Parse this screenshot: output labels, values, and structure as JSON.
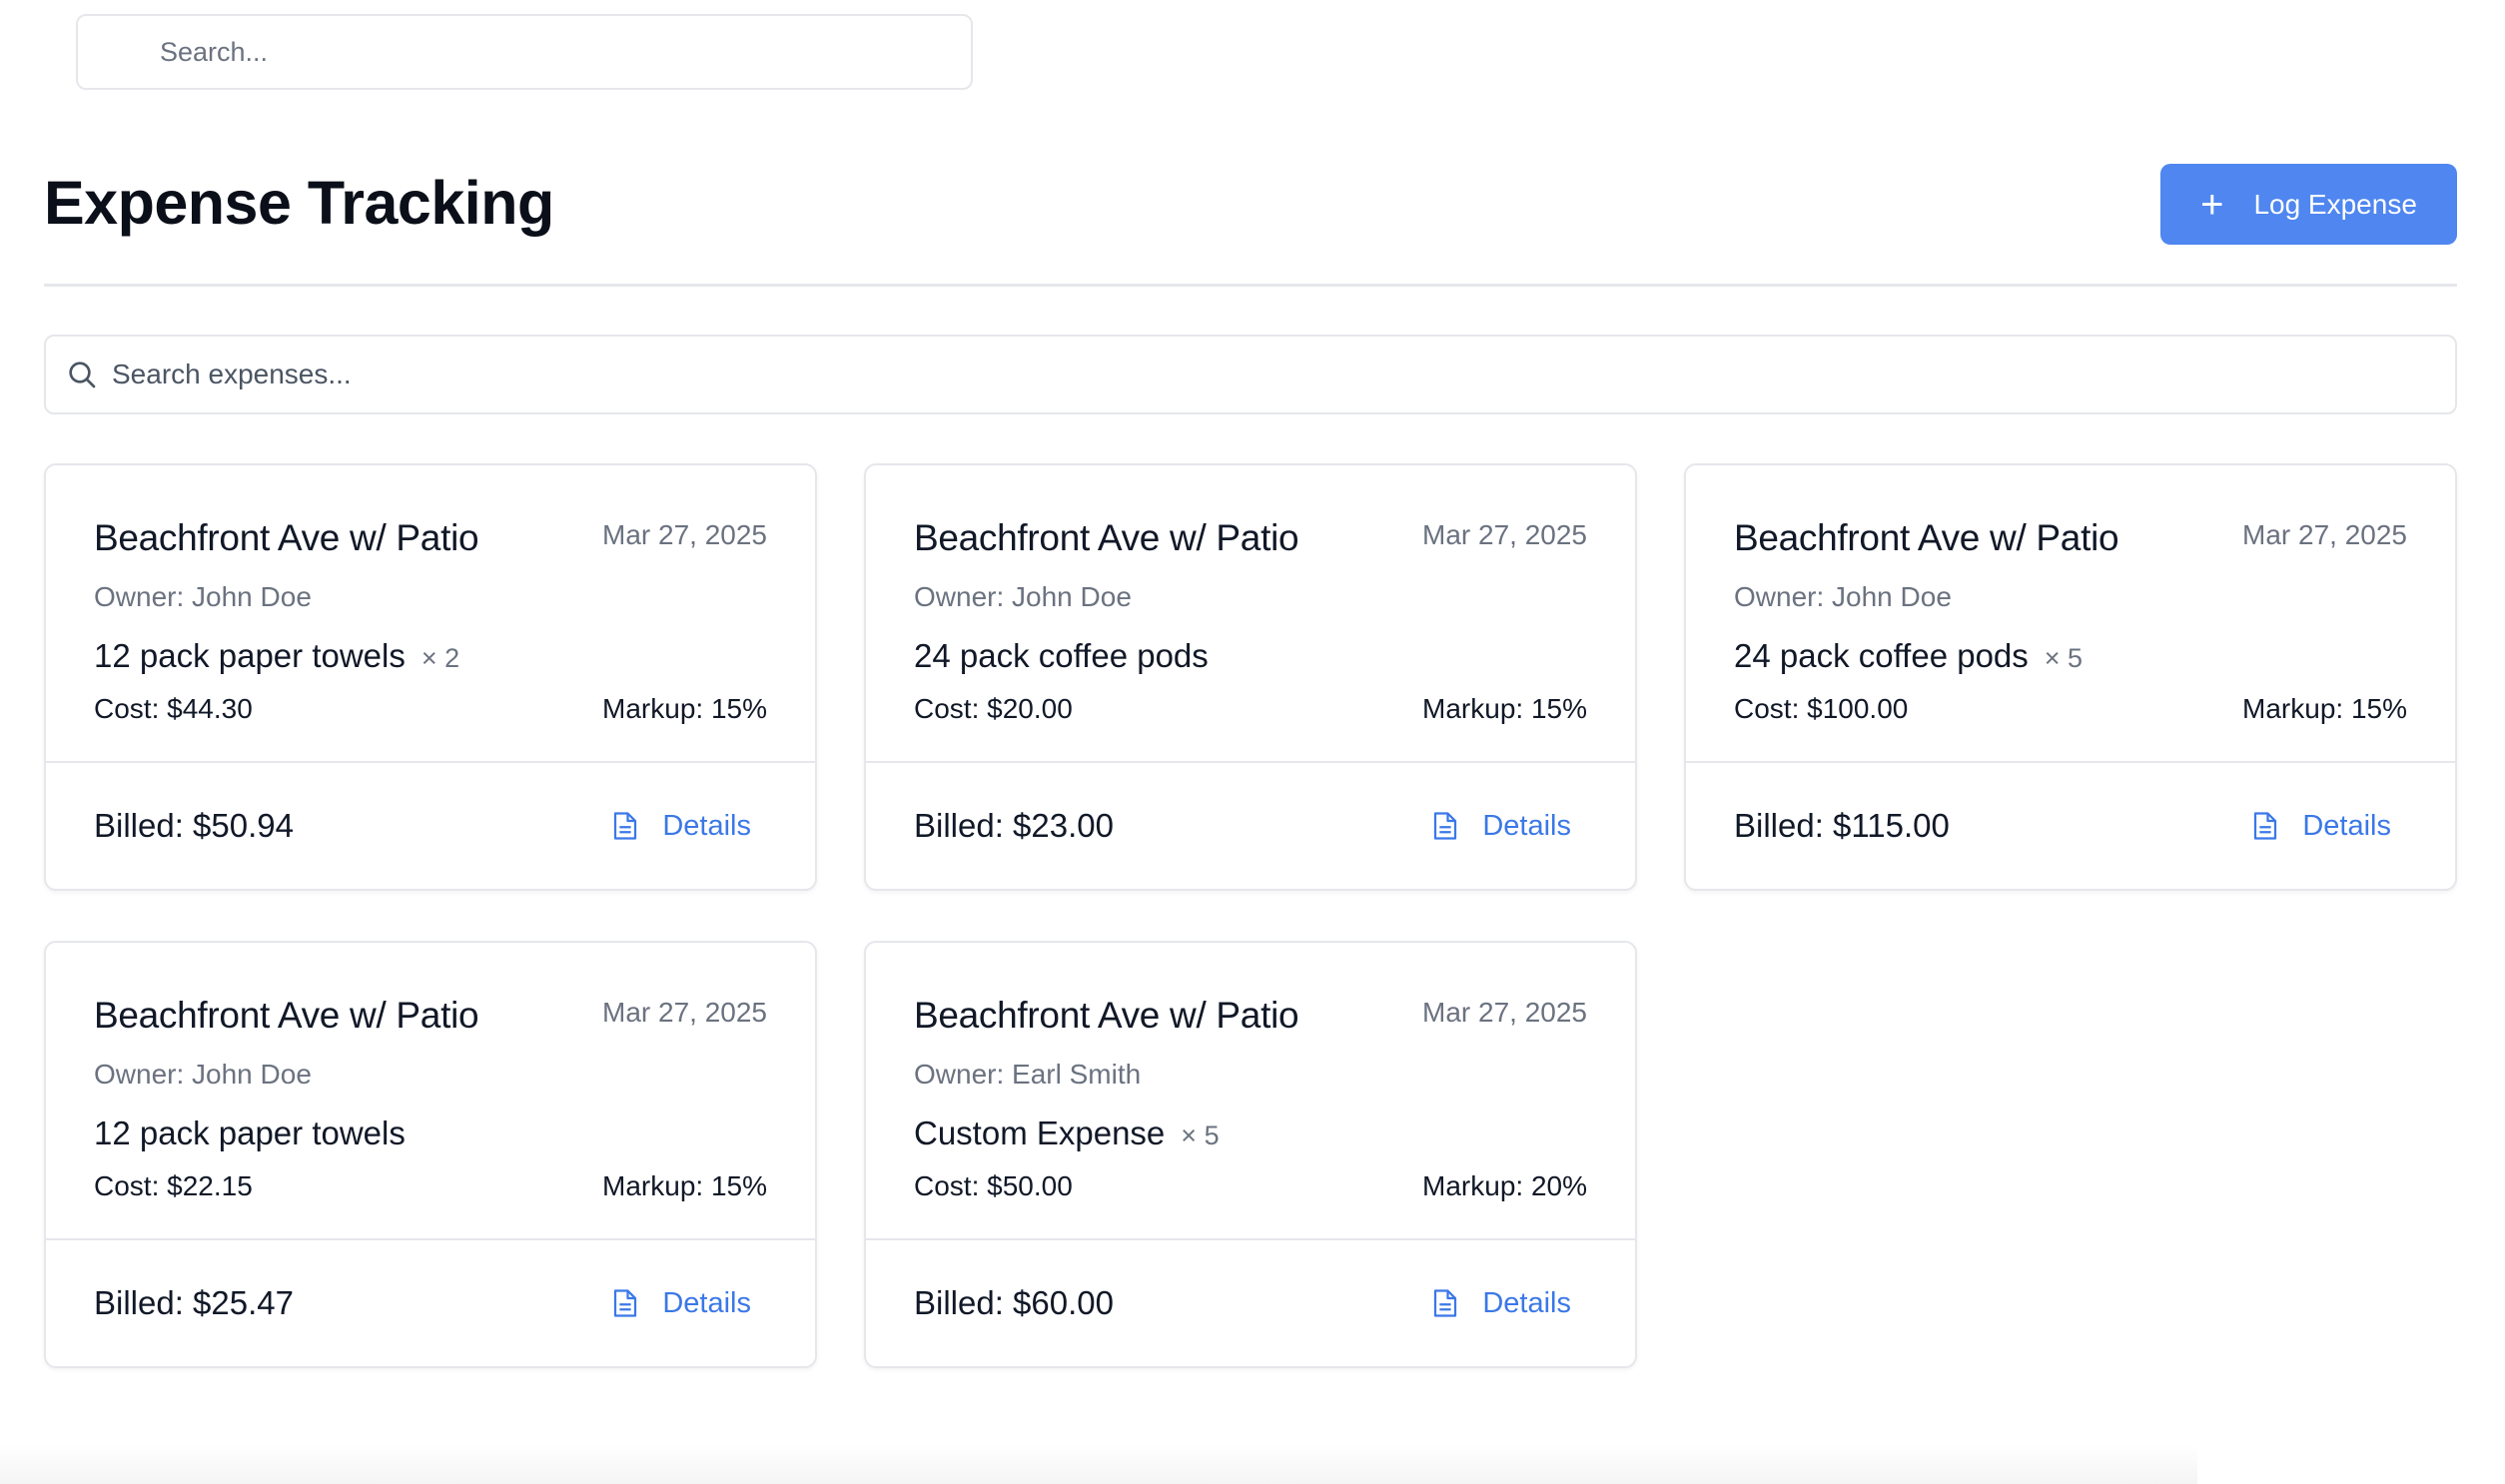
{
  "top_search": {
    "placeholder": "Search..."
  },
  "header": {
    "title": "Expense Tracking",
    "log_button_label": "Log Expense",
    "log_button_icon": "plus-icon"
  },
  "expense_search": {
    "placeholder": "Search expenses..."
  },
  "colors": {
    "accent": "#4f86f0",
    "link": "#3b78e7",
    "muted_text": "#6b7280",
    "border": "#e5e7eb"
  },
  "cards": [
    {
      "title": "Beachfront Ave w/ Patio",
      "date": "Mar 27, 2025",
      "owner": "Owner: John Doe",
      "item": "12 pack paper towels",
      "qty": "× 2",
      "cost": "Cost: $44.30",
      "markup": "Markup: 15%",
      "billed": "Billed: $50.94",
      "details": "Details"
    },
    {
      "title": "Beachfront Ave w/ Patio",
      "date": "Mar 27, 2025",
      "owner": "Owner: John Doe",
      "item": "24 pack coffee pods",
      "qty": "",
      "cost": "Cost: $20.00",
      "markup": "Markup: 15%",
      "billed": "Billed: $23.00",
      "details": "Details"
    },
    {
      "title": "Beachfront Ave w/ Patio",
      "date": "Mar 27, 2025",
      "owner": "Owner: John Doe",
      "item": "24 pack coffee pods",
      "qty": "× 5",
      "cost": "Cost: $100.00",
      "markup": "Markup: 15%",
      "billed": "Billed: $115.00",
      "details": "Details"
    },
    {
      "title": "Beachfront Ave w/ Patio",
      "date": "Mar 27, 2025",
      "owner": "Owner: John Doe",
      "item": "12 pack paper towels",
      "qty": "",
      "cost": "Cost: $22.15",
      "markup": "Markup: 15%",
      "billed": "Billed: $25.47",
      "details": "Details"
    },
    {
      "title": "Beachfront Ave w/ Patio",
      "date": "Mar 27, 2025",
      "owner": "Owner: Earl Smith",
      "item": "Custom Expense",
      "qty": "× 5",
      "cost": "Cost: $50.00",
      "markup": "Markup: 20%",
      "billed": "Billed: $60.00",
      "details": "Details"
    }
  ]
}
